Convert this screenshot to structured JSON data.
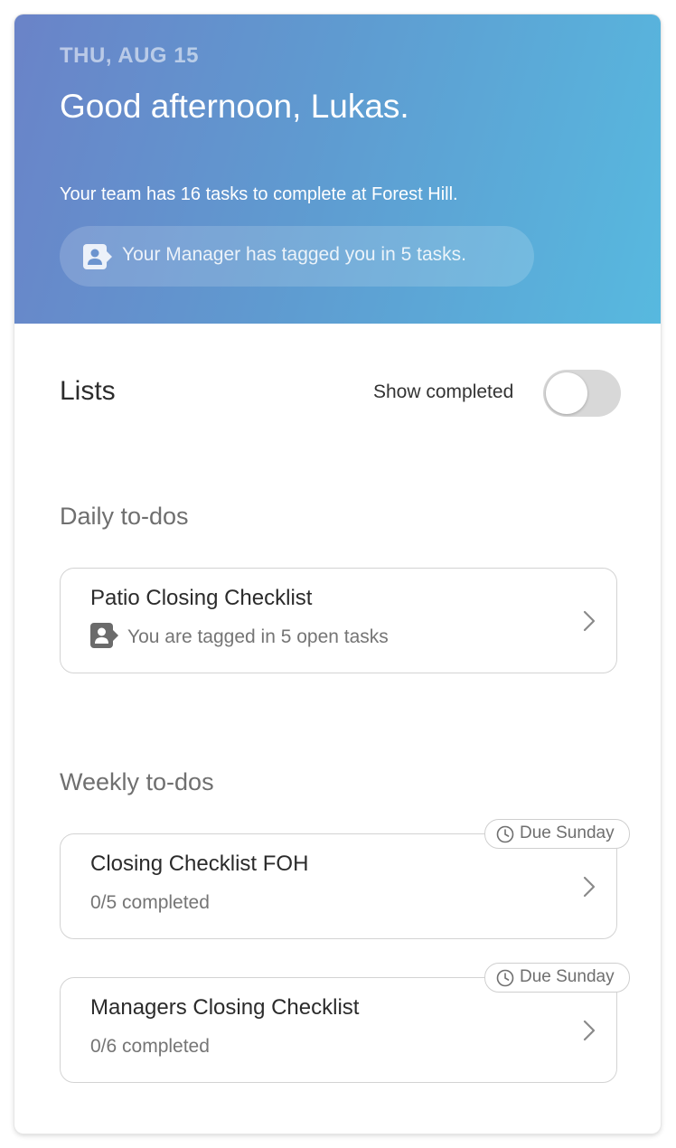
{
  "header": {
    "date": "THU, AUG 15",
    "greeting": "Good afternoon, Lukas.",
    "summary": "Your team has 16 tasks to complete at Forest Hill.",
    "tag_notice": "Your Manager has tagged you in 5 tasks.",
    "tag_icon": "tagged-user-icon"
  },
  "lists": {
    "title": "Lists",
    "show_completed_label": "Show completed",
    "show_completed_on": false
  },
  "daily": {
    "title": "Daily to-dos",
    "items": [
      {
        "title": "Patio Closing Checklist",
        "subtitle": "You are tagged in 5 open tasks",
        "icon": "tagged-user-icon"
      }
    ]
  },
  "weekly": {
    "title": "Weekly to-dos",
    "items": [
      {
        "title": "Closing Checklist FOH",
        "subtitle": "0/5 completed",
        "due": "Due Sunday"
      },
      {
        "title": "Managers Closing Checklist",
        "subtitle": "0/6 completed",
        "due": "Due Sunday"
      }
    ]
  },
  "colors": {
    "gradient_start": "#6a83c8",
    "gradient_end": "#57b9df",
    "toggle_off": "#d8d8d8"
  }
}
